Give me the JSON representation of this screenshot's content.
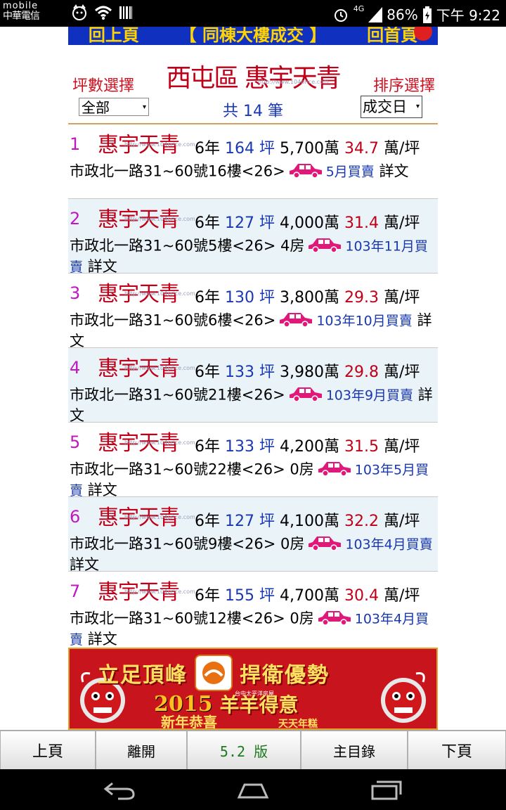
{
  "status_bar": {
    "carrier": "中華電信",
    "network": "4G",
    "battery": "86%",
    "time": "下午 9:22"
  },
  "top_banner": {
    "left": "回上頁",
    "middle": "【 同棟大樓成交 】",
    "right": "回首頁"
  },
  "header": {
    "title": "西屯區 惠宇天青",
    "watermark": "http://www.104price.com",
    "area_label": "坪數選擇",
    "sort_label": "排序選擇",
    "area_select": "全部",
    "sort_select": "成交日",
    "count_text": "共 14 筆"
  },
  "listings": [
    {
      "index": "1",
      "name": "惠宇天青",
      "age": "6年",
      "ping": "164",
      "ping_unit": "坪",
      "price": "5,700萬",
      "unit_price": "34.7",
      "unit_label": "萬/坪",
      "address": "市政北一路31~60號16樓<26>",
      "rooms": "",
      "date": "5月買賣",
      "detail": "詳文",
      "idx_color": "#c018c0"
    },
    {
      "index": "2",
      "name": "惠宇天青",
      "age": "6年",
      "ping": "127",
      "ping_unit": "坪",
      "price": "4,000萬",
      "unit_price": "31.4",
      "unit_label": "萬/坪",
      "address": "市政北一路31~60號5樓<26>",
      "rooms": "4房",
      "date": "103年11月買賣",
      "detail": "詳文",
      "idx_color": "#c018c0"
    },
    {
      "index": "3",
      "name": "惠宇天青",
      "age": "6年",
      "ping": "130",
      "ping_unit": "坪",
      "price": "3,800萬",
      "unit_price": "29.3",
      "unit_label": "萬/坪",
      "address": "市政北一路31~60號6樓<26>",
      "rooms": "",
      "date": "103年10月買賣",
      "detail": "詳文",
      "idx_color": "#c018c0"
    },
    {
      "index": "4",
      "name": "惠宇天青",
      "age": "6年",
      "ping": "133",
      "ping_unit": "坪",
      "price": "3,980萬",
      "unit_price": "29.8",
      "unit_label": "萬/坪",
      "address": "市政北一路31~60號21樓<26>",
      "rooms": "",
      "date": "103年9月買賣",
      "detail": "詳文",
      "idx_color": "#c018c0"
    },
    {
      "index": "5",
      "name": "惠宇天青",
      "age": "6年",
      "ping": "133",
      "ping_unit": "坪",
      "price": "4,200萬",
      "unit_price": "31.5",
      "unit_label": "萬/坪",
      "address": "市政北一路31~60號22樓<26>",
      "rooms": "0房",
      "date": "103年5月買賣",
      "detail": "詳文",
      "idx_color": "#c018c0"
    },
    {
      "index": "6",
      "name": "惠宇天青",
      "age": "6年",
      "ping": "127",
      "ping_unit": "坪",
      "price": "4,100萬",
      "unit_price": "32.2",
      "unit_label": "萬/坪",
      "address": "市政北一路31~60號9樓<26>",
      "rooms": "0房",
      "date": "103年4月買賣",
      "detail": "詳文",
      "idx_color": "#c018c0"
    },
    {
      "index": "7",
      "name": "惠宇天青",
      "age": "6年",
      "ping": "155",
      "ping_unit": "坪",
      "price": "4,700萬",
      "unit_price": "30.4",
      "unit_label": "萬/坪",
      "address": "市政北一路31~60號12樓<26>",
      "rooms": "0房",
      "date": "103年4月買賣",
      "detail": "詳文",
      "idx_color": "#c018c0"
    }
  ],
  "ad": {
    "left_text": "立足頂峰",
    "right_text": "捍衛優勢",
    "brand": "台中太平洋房屋",
    "year": "2015",
    "yang": "羊羊得意",
    "new_year": "新年恭喜",
    "tail": "天天年糕"
  },
  "toolbar": {
    "prev": "上頁",
    "leave": "離開",
    "version": "5.2 版",
    "menu": "主目錄",
    "next": "下頁"
  },
  "colors": {
    "name_red": "#c00018",
    "blue": "#1a38b0",
    "car_pink": "#e0187a",
    "banner_blue": "#1030c0"
  },
  "icons": [
    "cat-icon",
    "wifi-icon",
    "barcode-icon",
    "alarm-icon",
    "signal-icon",
    "battery-icon",
    "car-icon",
    "back-icon",
    "home-icon",
    "recent-apps-icon"
  ]
}
